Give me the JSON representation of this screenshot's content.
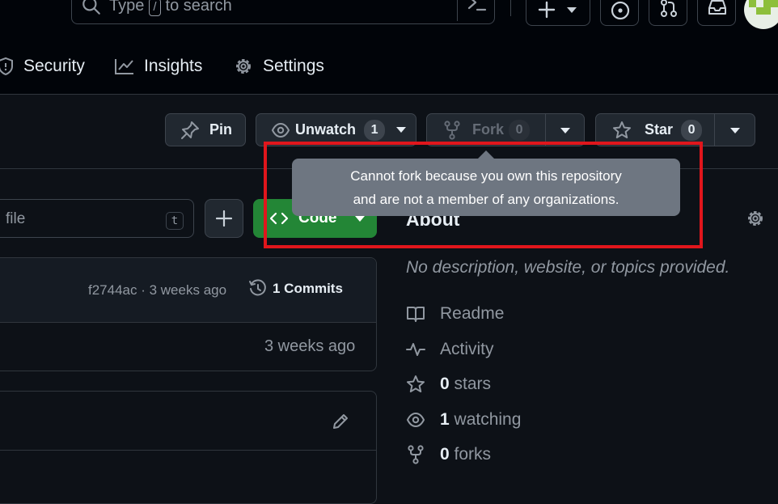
{
  "header": {
    "search_prefix": "Type",
    "search_key": "/",
    "search_suffix": "to search"
  },
  "tabs": [
    {
      "label": "Security"
    },
    {
      "label": "Insights"
    },
    {
      "label": "Settings"
    }
  ],
  "actions": {
    "pin_label": "Pin",
    "unwatch_label": "Unwatch",
    "unwatch_count": "1",
    "fork_label": "Fork",
    "fork_count": "0",
    "star_label": "Star",
    "star_count": "0"
  },
  "tooltip": {
    "line1": "Cannot fork because you own this repository",
    "line2": "and are not a member of any organizations."
  },
  "file_bar": {
    "search_placeholder": "file",
    "shortcut_key": "t",
    "code_label": "Code"
  },
  "commit_header": {
    "info": "f2744ac · 3 weeks ago",
    "commits_label": "1 Commits"
  },
  "file_row": {
    "time": "3 weeks ago"
  },
  "about": {
    "title": "About",
    "description": "No description, website, or topics provided.",
    "readme": "Readme",
    "activity": "Activity",
    "stars_count": "0",
    "stars_label": "stars",
    "watching_count": "1",
    "watching_label": "watching",
    "forks_count": "0",
    "forks_label": "forks"
  },
  "colors": {
    "background": "#0d1117",
    "header_background": "#010409",
    "code_button": "#238636",
    "tooltip": "#6e7681",
    "highlight_outline": "#e0161c"
  }
}
